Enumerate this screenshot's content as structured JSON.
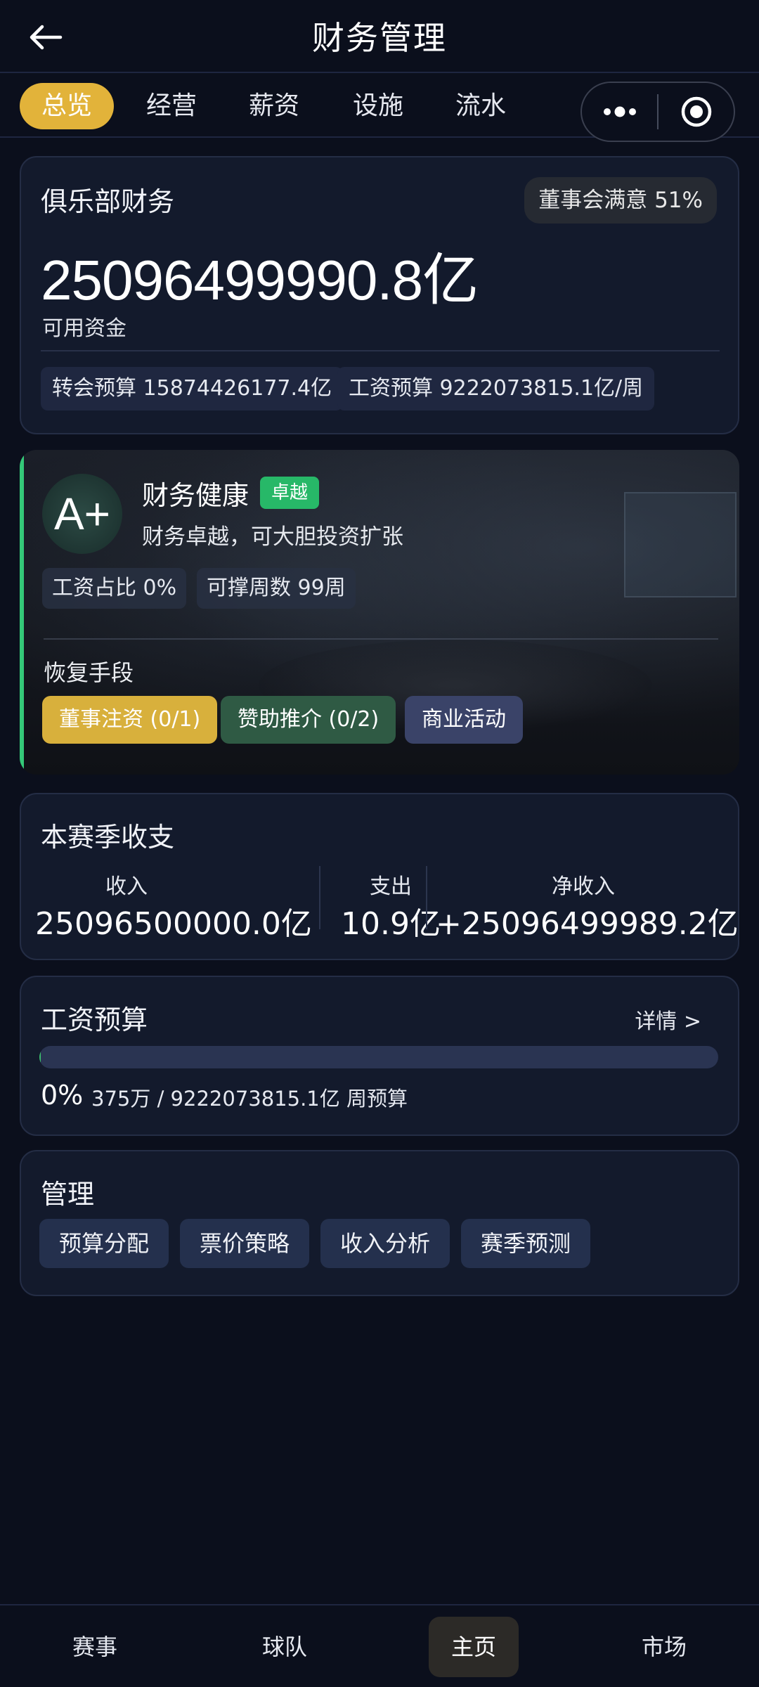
{
  "header": {
    "title": "财务管理"
  },
  "tabs": [
    {
      "label": "总览",
      "active": true
    },
    {
      "label": "经营",
      "active": false
    },
    {
      "label": "薪资",
      "active": false
    },
    {
      "label": "设施",
      "active": false
    },
    {
      "label": "流水",
      "active": false
    }
  ],
  "finance": {
    "title": "俱乐部财务",
    "board_satisfaction": "董事会满意 51%",
    "available_funds": "25096499990.8亿",
    "available_label": "可用资金",
    "transfer_budget": "转会预算 15874426177.4亿",
    "wage_budget": "工资预算 9222073815.1亿/周"
  },
  "health": {
    "grade": "A+",
    "title": "财务健康",
    "badge": "卓越",
    "description": "财务卓越，可大胆投资扩张",
    "wage_ratio": "工资占比 0%",
    "weeks_sustainable": "可撑周数 99周",
    "recovery_label": "恢复手段",
    "actions": [
      {
        "label": "董事注资 (0/1)",
        "color": "#d8b03c"
      },
      {
        "label": "赞助推介 (0/2)",
        "color": "#2f5a44"
      },
      {
        "label": "商业活动",
        "color": "#3a4368"
      }
    ]
  },
  "season": {
    "title": "本赛季收支",
    "income_label": "收入",
    "income_value": "25096500000.0亿",
    "expense_label": "支出",
    "expense_value": "10.9亿",
    "net_label": "净收入",
    "net_value": "+25096499989.2亿"
  },
  "salary": {
    "title": "工资预算",
    "details": "详情 >",
    "percent": "0%",
    "progress_fraction": 0.002,
    "budget_text": "375万 / 9222073815.1亿 周预算"
  },
  "manage": {
    "title": "管理",
    "buttons": [
      "预算分配",
      "票价策略",
      "收入分析",
      "赛季预测"
    ]
  },
  "bottom_nav": [
    {
      "label": "赛事",
      "active": false
    },
    {
      "label": "球队",
      "active": false
    },
    {
      "label": "主页",
      "active": true
    },
    {
      "label": "市场",
      "active": false
    }
  ]
}
